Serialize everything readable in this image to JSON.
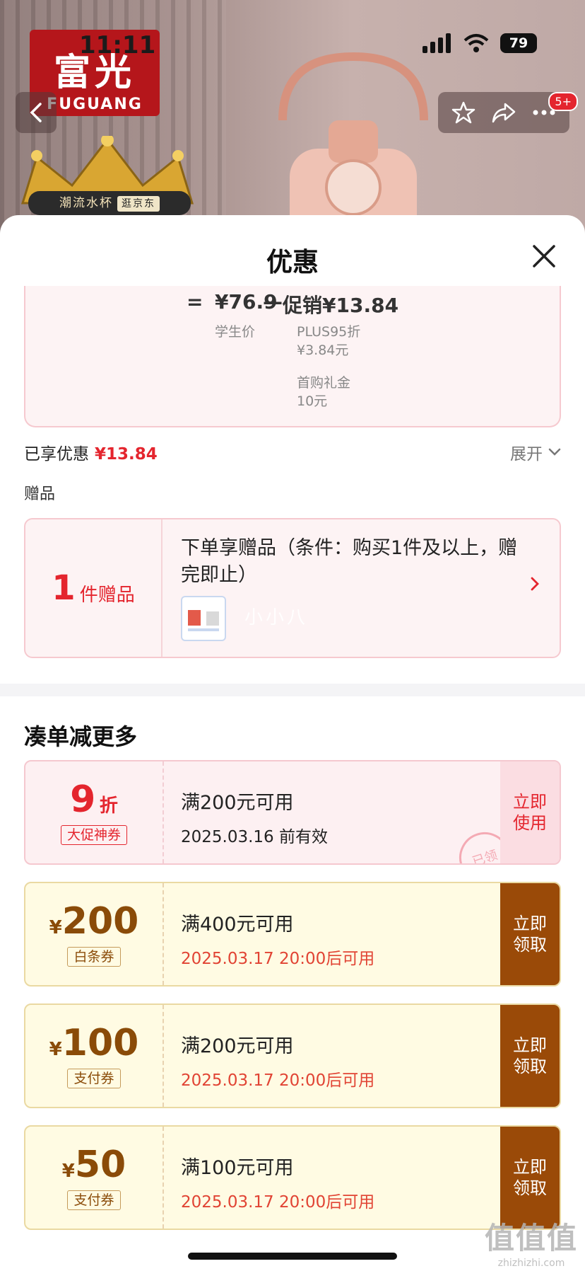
{
  "status_bar": {
    "time": "11:11",
    "battery": "79"
  },
  "hero": {
    "brand_cn": "富光",
    "brand_en": "FUGUANG",
    "banner_text": "潮流水杯",
    "banner_tag": "逛京东",
    "cart_badge": "5+"
  },
  "sheet": {
    "title": "优惠"
  },
  "calculation": {
    "equals": "=",
    "price": "¥76.9",
    "minus": "—",
    "promo_label": "促销¥13.84",
    "price_caption": "学生价",
    "detail_1_name": "PLUS95折",
    "detail_1_value": "¥3.84元",
    "detail_2_name": "首购礼金",
    "detail_2_value": "10元"
  },
  "enjoyed": {
    "label": "已享优惠",
    "amount": "¥13.84",
    "expand_label": "展开"
  },
  "gift": {
    "section_label": "赠品",
    "count": "1",
    "count_unit": "件赠品",
    "description": "下单享赠品（条件：购买1件及以上，赠完即止）",
    "watermark_text": "小小八"
  },
  "more_section": {
    "title": "凑单减更多"
  },
  "coupons": [
    {
      "amount": "9",
      "unit": "折",
      "tag": "大促神券",
      "condition": "满200元可用",
      "time": "2025.03.16 前有效",
      "button_line1": "立即",
      "button_line2": "使用",
      "stamp": "已领"
    },
    {
      "currency": "¥",
      "amount": "200",
      "tag": "白条券",
      "condition": "满400元可用",
      "time": "2025.03.17 20:00后可用",
      "button_line1": "立即",
      "button_line2": "领取"
    },
    {
      "currency": "¥",
      "amount": "100",
      "tag": "支付券",
      "condition": "满200元可用",
      "time": "2025.03.17 20:00后可用",
      "button_line1": "立即",
      "button_line2": "领取"
    },
    {
      "currency": "¥",
      "amount": "50",
      "tag": "支付券",
      "condition": "满100元可用",
      "time": "2025.03.17 20:00后可用",
      "button_line1": "立即",
      "button_line2": "领取"
    }
  ],
  "watermark": {
    "logo": "值值值",
    "site": "zhizhizhi.com"
  },
  "colors": {
    "accent_red": "#e4252e",
    "coupon_brown": "#9a4a08",
    "coupon_yellow_bg": "#fffbe3",
    "pink_bg": "#fdf0f2"
  }
}
